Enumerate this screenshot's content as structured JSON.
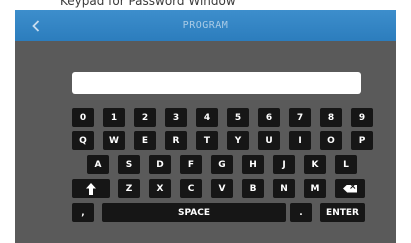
{
  "caption": "Keypad for Password Window",
  "header": {
    "title": "PROGRAM",
    "back_icon": "chevron-left-icon",
    "accent": "#2f80c0"
  },
  "password": {
    "value": ""
  },
  "keyboard": {
    "row1": [
      "0",
      "1",
      "2",
      "3",
      "4",
      "5",
      "6",
      "7",
      "8",
      "9"
    ],
    "row2": [
      "Q",
      "W",
      "E",
      "R",
      "T",
      "Y",
      "U",
      "I",
      "O",
      "P"
    ],
    "row3": [
      "A",
      "S",
      "D",
      "F",
      "G",
      "H",
      "J",
      "K",
      "L"
    ],
    "row4": [
      "Z",
      "X",
      "C",
      "V",
      "B",
      "N",
      "M"
    ],
    "shift_icon": "shift-arrow-icon",
    "backspace_icon": "backspace-icon",
    "comma": ",",
    "space": "SPACE",
    "period": ".",
    "enter": "ENTER"
  }
}
